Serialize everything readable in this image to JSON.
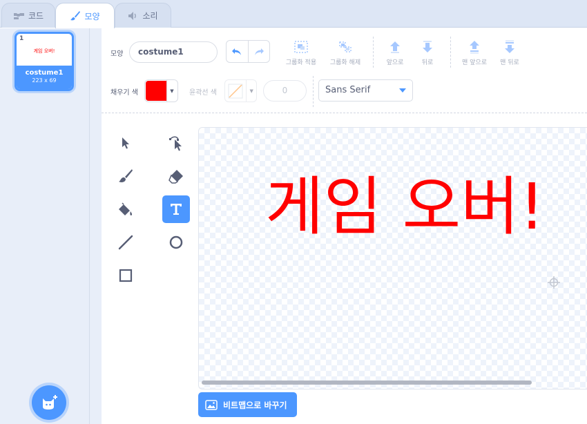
{
  "tabs": {
    "code": "코드",
    "costumes": "모양",
    "sounds": "소리"
  },
  "sidebar": {
    "costume": {
      "number": "1",
      "thumbnail_text": "게임 오버!",
      "name": "costume1",
      "size": "223 x 69"
    }
  },
  "toolbar": {
    "costume_label": "모양",
    "costume_name": "costume1",
    "group": "그룹화 적용",
    "ungroup": "그룹화 해제",
    "forward": "앞으로",
    "backward": "뒤로",
    "front": "맨 앞으로",
    "back": "맨 뒤로",
    "fill_label": "채우기 색",
    "outline_label": "윤곽선 색",
    "outline_width": "0",
    "font": "Sans Serif"
  },
  "colors": {
    "fill": "#ff0000",
    "accent": "#4c97ff"
  },
  "canvas": {
    "text": "게임 오버!"
  },
  "bitmap_button": "비트맵으로 바꾸기"
}
